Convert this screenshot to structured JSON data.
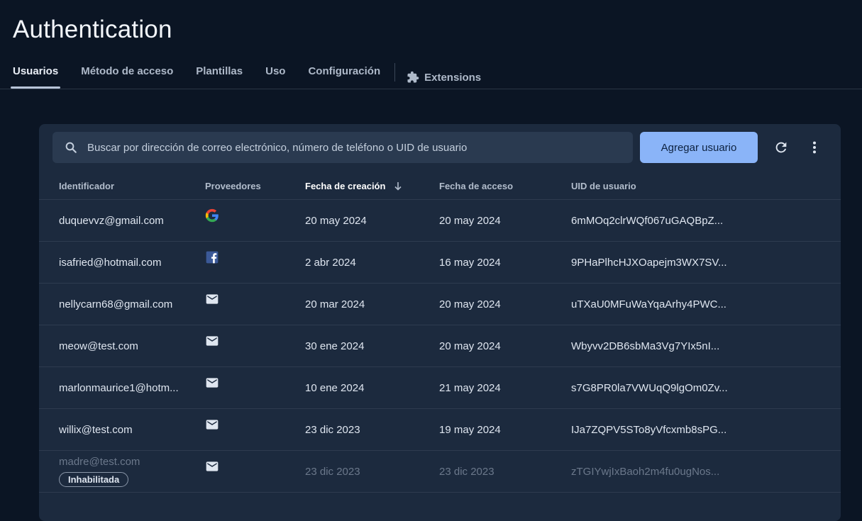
{
  "header": {
    "title": "Authentication",
    "tabs": [
      {
        "label": "Usuarios",
        "active": true
      },
      {
        "label": "Método de acceso"
      },
      {
        "label": "Plantillas"
      },
      {
        "label": "Uso"
      },
      {
        "label": "Configuración"
      },
      {
        "label": "Extensions",
        "icon": "puzzle-icon"
      }
    ]
  },
  "toolbar": {
    "search_placeholder": "Buscar por dirección de correo electrónico, número de teléfono o UID de usuario",
    "add_user_label": "Agregar usuario",
    "refresh_icon": "refresh-icon",
    "more_icon": "more-vert-icon"
  },
  "table": {
    "columns": {
      "identifier": "Identificador",
      "providers": "Proveedores",
      "created": "Fecha de creación",
      "signed_in": "Fecha de acceso",
      "uid": "UID de usuario"
    },
    "sort_column": "created",
    "sort_direction": "descending",
    "rows": [
      {
        "identifier": "duquevvz@gmail.com",
        "provider": "google",
        "created": "20 may 2024",
        "signed_in": "20 may 2024",
        "uid": "6mMOq2clrWQf067uGAQBpZ..."
      },
      {
        "identifier": "isafried@hotmail.com",
        "provider": "facebook",
        "created": "2 abr 2024",
        "signed_in": "16 may 2024",
        "uid": "9PHaPlhcHJXOapejm3WX7SV..."
      },
      {
        "identifier": "nellycarn68@gmail.com",
        "provider": "email",
        "created": "20 mar 2024",
        "signed_in": "20 may 2024",
        "uid": "uTXaU0MFuWaYqaArhy4PWC..."
      },
      {
        "identifier": "meow@test.com",
        "provider": "email",
        "created": "30 ene 2024",
        "signed_in": "20 may 2024",
        "uid": "Wbyvv2DB6sbMa3Vg7YIx5nI..."
      },
      {
        "identifier": "marlonmaurice1@hotm...",
        "provider": "email",
        "created": "10 ene 2024",
        "signed_in": "21 may 2024",
        "uid": "s7G8PR0la7VWUqQ9lgOm0Zv..."
      },
      {
        "identifier": "willix@test.com",
        "provider": "email",
        "created": "23 dic 2023",
        "signed_in": "19 may 2024",
        "uid": "IJa7ZQPV5STo8yVfcxmb8sPG..."
      },
      {
        "identifier": "madre@test.com",
        "provider": "email",
        "created": "23 dic 2023",
        "signed_in": "23 dic 2023",
        "uid": "zTGIYwjIxBaoh2m4fu0ugNos...",
        "badge": "Inhabilitada",
        "disabled": true
      }
    ]
  }
}
